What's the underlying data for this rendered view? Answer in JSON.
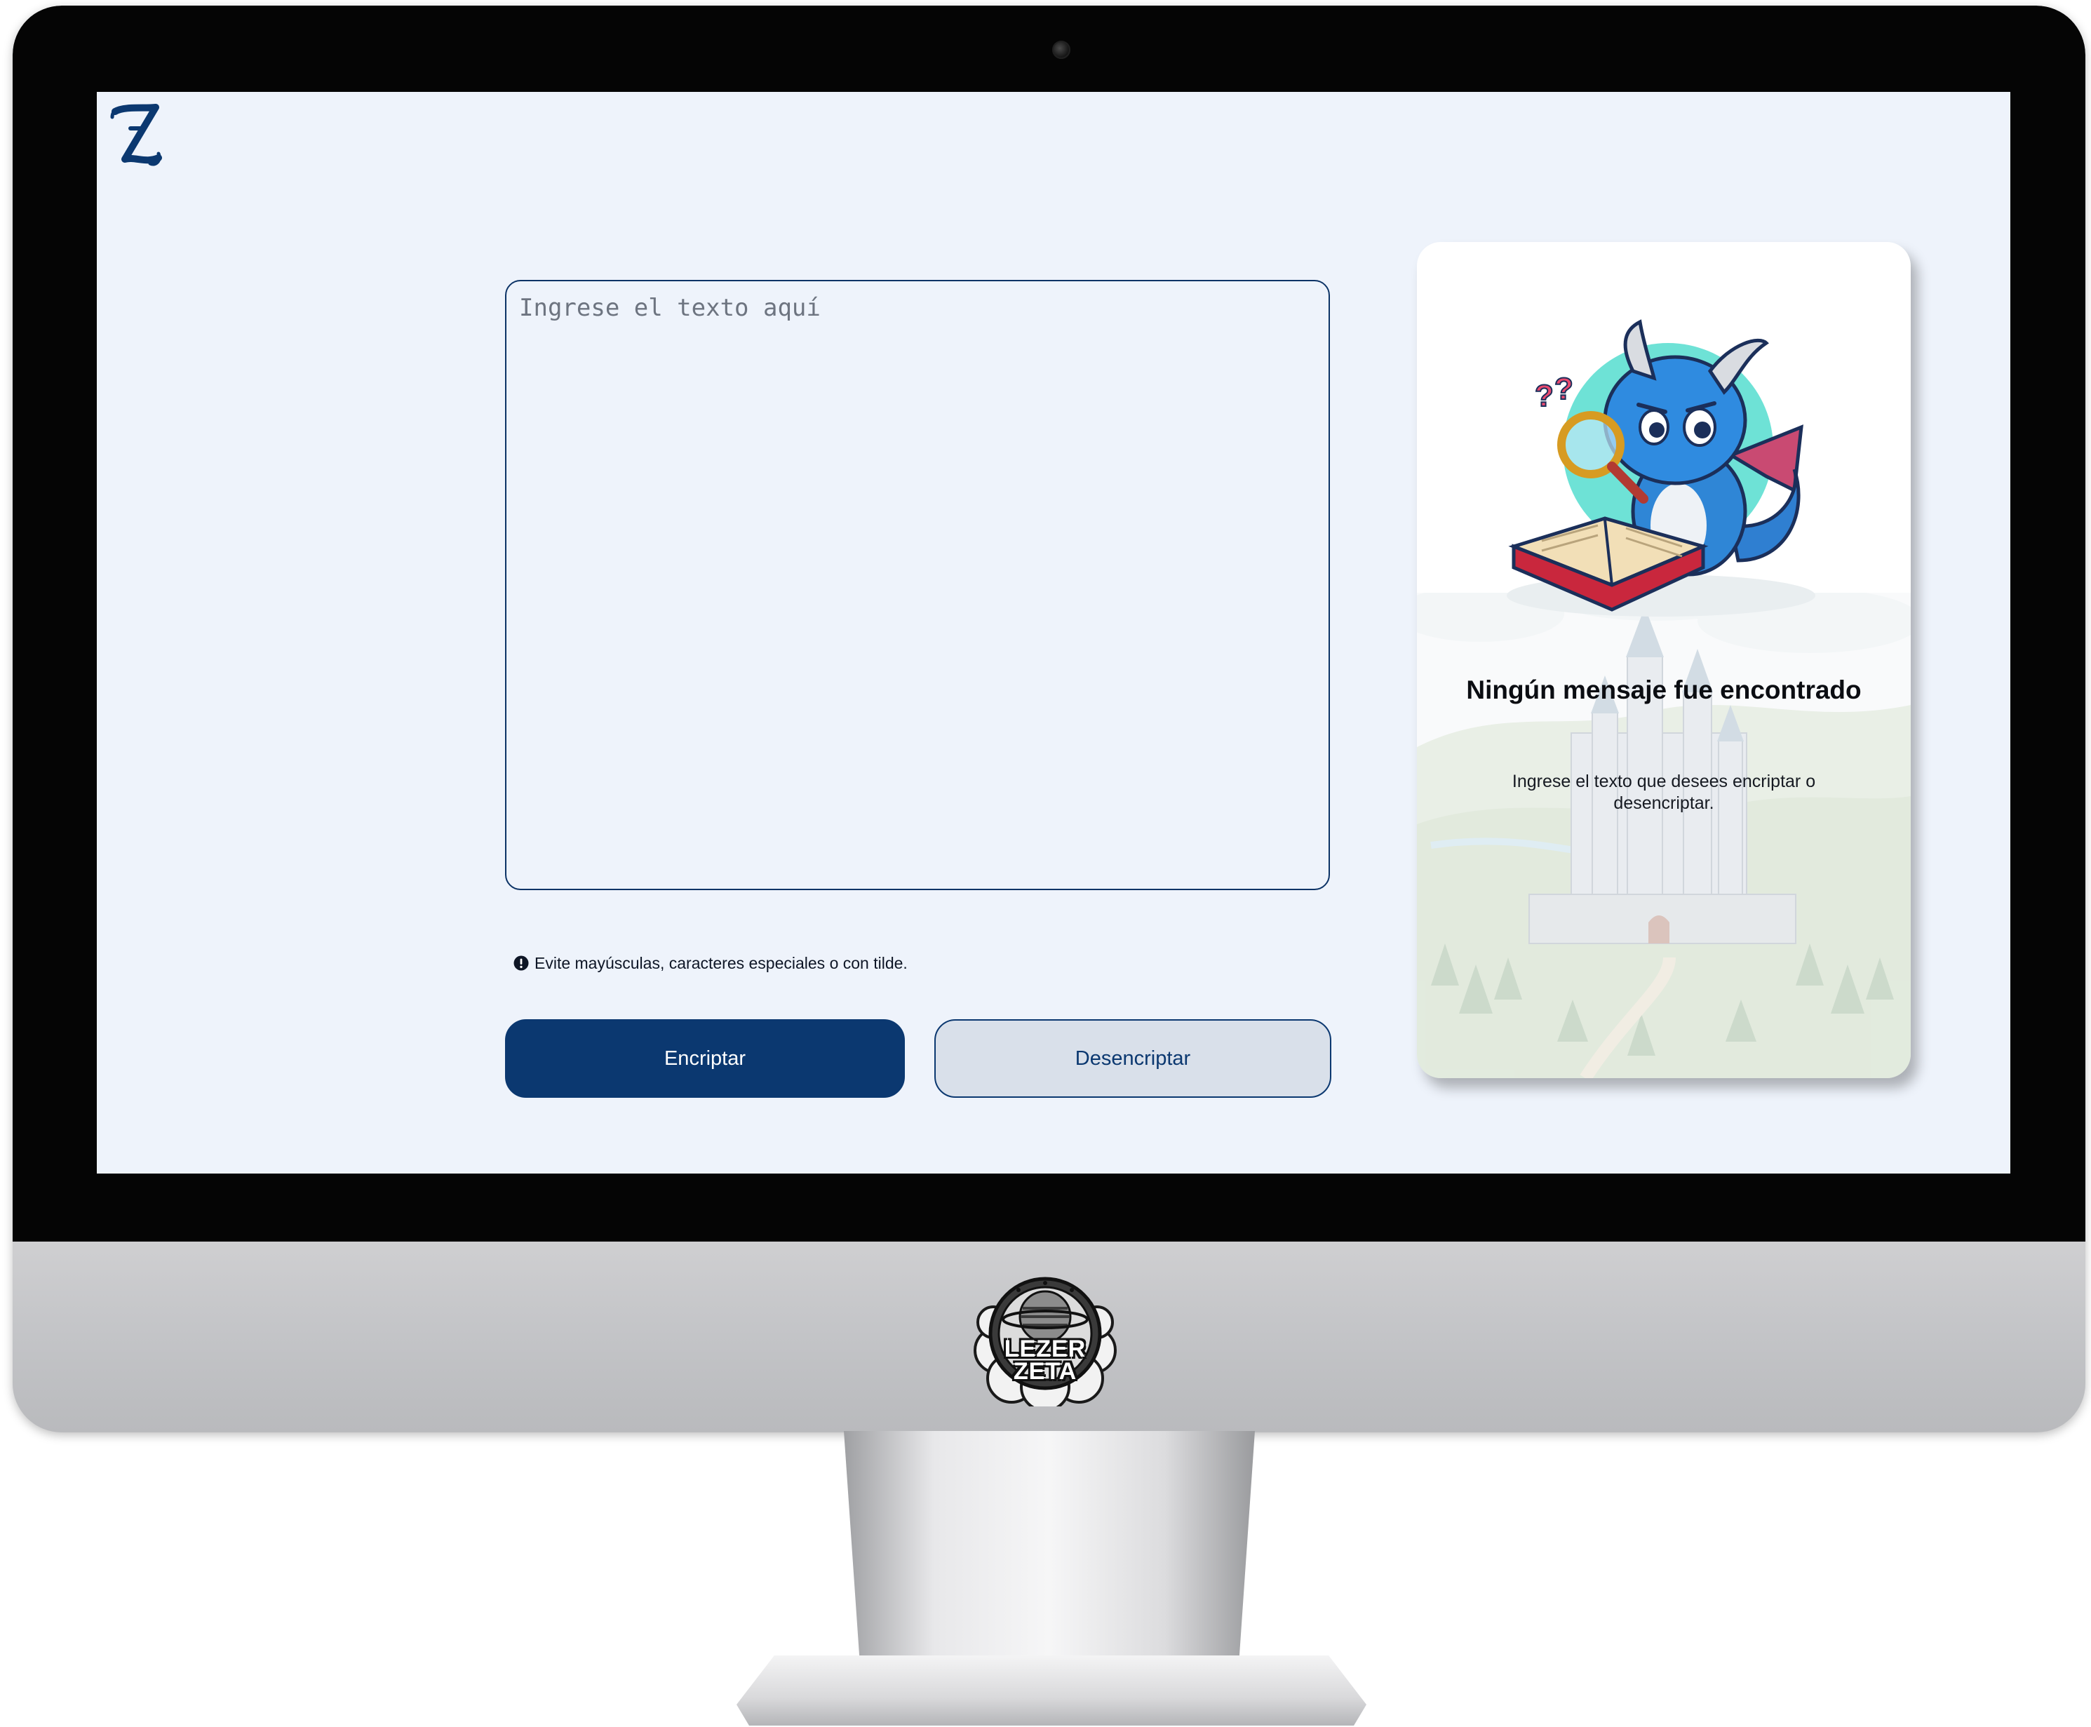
{
  "app": {
    "logo_letter": "Z"
  },
  "editor": {
    "placeholder": "Ingrese el texto aquí",
    "value": ""
  },
  "notice": {
    "icon": "info-icon",
    "text": "Evite mayúsculas, caracteres especiales o con tilde."
  },
  "actions": {
    "encrypt_label": "Encriptar",
    "decrypt_label": "Desencriptar"
  },
  "result": {
    "title": "Ningún mensaje fue encontrado",
    "message": "Ingrese el texto que desees encriptar o desencriptar.",
    "illustration": "dragon-with-magnifier-and-book",
    "background": "castle-landscape"
  },
  "device": {
    "brand_logo_text": "LEZER ZETA"
  },
  "colors": {
    "primary": "#0b3870",
    "screen_background": "#eef3fb",
    "secondary_button": "#d9e0ea",
    "card_background": "#ffffff"
  }
}
